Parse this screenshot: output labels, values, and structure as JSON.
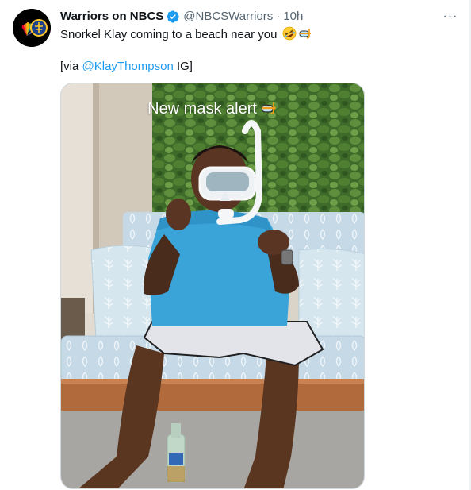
{
  "account": {
    "display_name": "Warriors on NBCS",
    "handle": "@NBCSWarriors",
    "separator": "·",
    "time": "10h",
    "avatar_icon": "warriors-nbcs-logo",
    "verified_icon": "verified-badge-icon"
  },
  "menu": {
    "more_label": "···"
  },
  "tweet": {
    "text_line1": "Snorkel Klay coming to a beach near you",
    "line1_emojis": [
      "rolling-on-floor-laughing-emoji",
      "diving-mask-emoji"
    ],
    "via_prefix": "[via ",
    "via_mention": "@KlayThompson",
    "via_suffix": " IG]"
  },
  "media": {
    "caption": "New mask alert",
    "caption_emoji": "diving-mask-emoji"
  },
  "colors": {
    "accent": "#1d9bf0",
    "text": "#0f1419",
    "secondary": "#536471"
  }
}
